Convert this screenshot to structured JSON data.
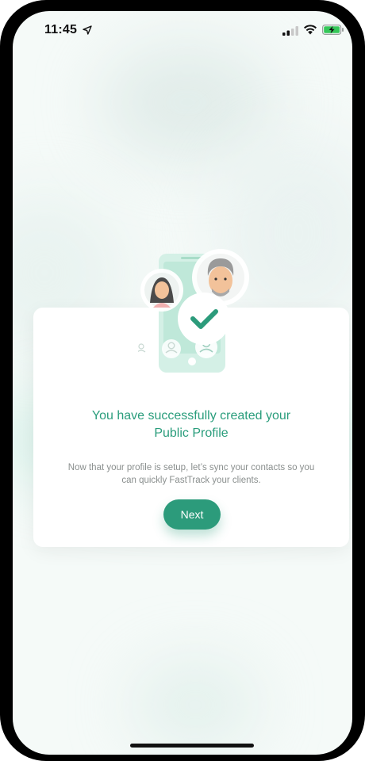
{
  "status_bar": {
    "time": "11:45",
    "location_glyph": "⍤"
  },
  "dialog": {
    "title_line1": "You have successfully created your",
    "title_line2": "Public Profile",
    "description_line1": "Now that your profile is setup, let’s sync your contacts so you",
    "description_line2": "can quickly FastTrack your clients.",
    "next_label": "Next"
  },
  "colors": {
    "accent": "#2c9b7b",
    "title": "#2a9d7c",
    "body_text": "#8a8f8e",
    "background": "#f5faf8"
  },
  "icons": {
    "status": [
      "location-arrow-icon",
      "signal-icon",
      "wifi-icon",
      "battery-charging-icon"
    ],
    "illustration": [
      "phone-icon",
      "avatar-man-icon",
      "avatar-woman-icon",
      "check-icon",
      "user-icon"
    ]
  }
}
